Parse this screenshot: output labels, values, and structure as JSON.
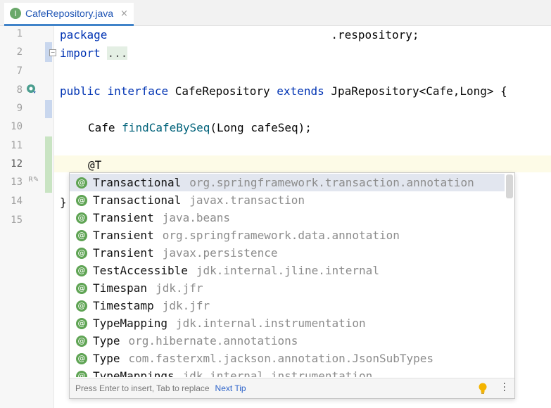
{
  "tab": {
    "icon": "interface-icon",
    "icon_letter": "I",
    "label": "CafeRepository.java",
    "close": "×"
  },
  "editor": {
    "line_numbers": [
      "1",
      "2",
      "7",
      "8",
      "9",
      "10",
      "11",
      "12",
      "13",
      "14",
      "15"
    ],
    "lines": {
      "l1_kw": "package",
      "l1_rest": ".respository;",
      "l2_kw": "import",
      "l2_dots": "...",
      "l8_kw1": "public",
      "l8_kw2": "interface",
      "l8_name": "CafeRepository",
      "l8_kw3": "extends",
      "l8_rest": "JpaRepository<Cafe,Long> {",
      "l10_type": "Cafe",
      "l10_method": "findCafeBySeq",
      "l10_args": "(Long cafeSeq);",
      "l12_text": "@T",
      "l14_text": "}"
    }
  },
  "completion": {
    "items": [
      {
        "name": "Transactional",
        "pkg": "org.springframework.transaction.annotation"
      },
      {
        "name": "Transactional",
        "pkg": "javax.transaction"
      },
      {
        "name": "Transient",
        "pkg": "java.beans"
      },
      {
        "name": "Transient",
        "pkg": "org.springframework.data.annotation"
      },
      {
        "name": "Transient",
        "pkg": "javax.persistence"
      },
      {
        "name": "TestAccessible",
        "pkg": "jdk.internal.jline.internal"
      },
      {
        "name": "Timespan",
        "pkg": "jdk.jfr"
      },
      {
        "name": "Timestamp",
        "pkg": "jdk.jfr"
      },
      {
        "name": "TypeMapping",
        "pkg": "jdk.internal.instrumentation"
      },
      {
        "name": "Type",
        "pkg": "org.hibernate.annotations"
      },
      {
        "name": "Type",
        "pkg": "com.fasterxml.jackson.annotation.JsonSubTypes"
      },
      {
        "name": "TypeMappings",
        "pkg": "jdk.internal.instrumentation"
      }
    ],
    "footer_hint": "Press Enter to insert, Tab to replace",
    "next_tip": "Next Tip"
  },
  "colors": {
    "keyword": "#0033b3",
    "method": "#00627a",
    "annotation_icon": "#5fa454",
    "link": "#2f65ca"
  }
}
